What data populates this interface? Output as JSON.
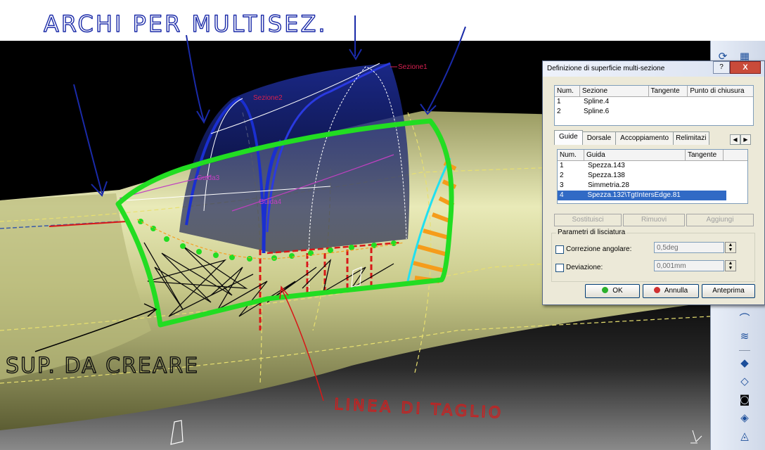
{
  "annotations": {
    "top": "ARCHI PER MULTISEZ.",
    "surface": "SUP. DA CREARE",
    "cut_line": "LINEA DI TAGLIO"
  },
  "scene_labels": {
    "section1": "Sezione1",
    "section2": "Sezione2",
    "guide3": "Guida3",
    "guide4": "Guida4"
  },
  "dialog": {
    "title": "Definizione di superficie multi-sezione",
    "help_label": "?",
    "close_label": "X",
    "sections_table": {
      "headers": [
        "Num.",
        "Sezione",
        "Tangente",
        "Punto di chiusura"
      ],
      "rows": [
        {
          "num": "1",
          "name": "Spline.4"
        },
        {
          "num": "2",
          "name": "Spline.6"
        }
      ]
    },
    "tabs": [
      "Guide",
      "Dorsale",
      "Accoppiamento",
      "Relimitazi"
    ],
    "active_tab": "Guide",
    "guides_table": {
      "headers": [
        "Num.",
        "Guida",
        "Tangente"
      ],
      "rows": [
        {
          "num": "1",
          "name": "Spezza.143"
        },
        {
          "num": "2",
          "name": "Spezza.138"
        },
        {
          "num": "3",
          "name": "Simmetria.28"
        },
        {
          "num": "4",
          "name": "Spezza.132\\TgtIntersEdge.81",
          "selected": true
        }
      ]
    },
    "buttons": {
      "replace": "Sostituisci",
      "remove": "Rimuovi",
      "add": "Aggiungi"
    },
    "smoothing": {
      "title": "Parametri di lisciatura",
      "angular_label": "Correzione angolare:",
      "angular_value": "0,5deg",
      "angular_checked": false,
      "deviation_label": "Deviazione:",
      "deviation_value": "0,001mm",
      "deviation_checked": false
    },
    "ok": "OK",
    "cancel": "Annulla",
    "preview": "Anteprima"
  },
  "toolbar": {
    "icons": [
      "sweep-icon",
      "multi-section-surface-icon",
      "blend-icon",
      "offset-icon",
      "fill-icon",
      "extrude-icon",
      "revolve-icon",
      "sphere-icon",
      "cylinder-icon"
    ]
  },
  "colors": {
    "fuselage": "#c8c98a",
    "canopy_outline": "#22dd22",
    "arch": "#1a2fd0",
    "arrows": "#1a2aa8",
    "cut_line": "#d81818",
    "hatch": "#f59c1a",
    "cyan_edge": "#20e0f0",
    "selection": "#316ac5"
  }
}
